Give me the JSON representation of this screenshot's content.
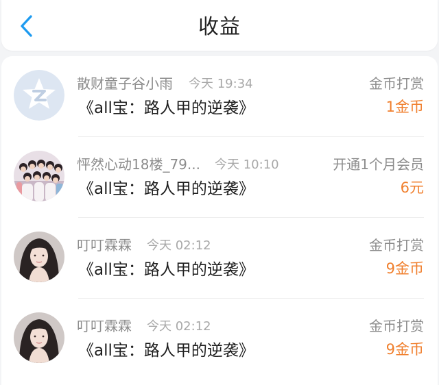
{
  "header": {
    "title": "收益",
    "back_icon": "chevron-left-icon",
    "accent_color": "#1e9bf0"
  },
  "records": [
    {
      "user": "散财童子谷小雨",
      "time": "今天 19:34",
      "work": "《all宝：路人甲的逆袭》",
      "type": "金币打赏",
      "amount": "1金币",
      "avatar": "default-z-logo-avatar"
    },
    {
      "user": "怦然心动18楼_79...",
      "time": "今天 10:10",
      "work": "《all宝：路人甲的逆袭》",
      "type": "开通1个月会员",
      "amount": "6元",
      "avatar": "group-photo-avatar"
    },
    {
      "user": "叮叮霖霖",
      "time": "今天 02:12",
      "work": "《all宝：路人甲的逆袭》",
      "type": "金币打赏",
      "amount": "9金币",
      "avatar": "portrait-photo-avatar"
    },
    {
      "user": "叮叮霖霖",
      "time": "今天 02:12",
      "work": "《all宝：路人甲的逆袭》",
      "type": "金币打赏",
      "amount": "9金币",
      "avatar": "portrait-photo-avatar"
    }
  ],
  "colors": {
    "amount": "#f07f2d",
    "secondary_text": "#8c8c8c",
    "primary_text": "#1f1f1f"
  }
}
